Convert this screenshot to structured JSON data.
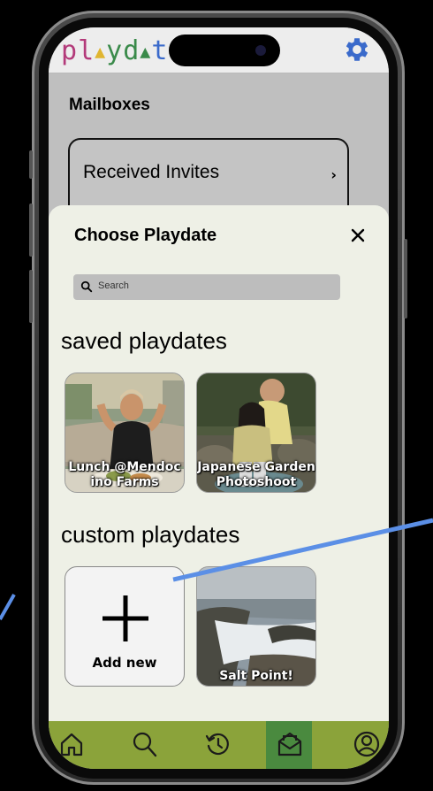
{
  "app": {
    "logo_letters": [
      {
        "ch": "p",
        "color": "#b33a7a"
      },
      {
        "ch": "l",
        "color": "#b33a7a"
      },
      {
        "ch": "▲",
        "color": "#e0b530"
      },
      {
        "ch": "y",
        "color": "#3a8a4a"
      },
      {
        "ch": "d",
        "color": "#3a8a4a"
      },
      {
        "ch": "▲",
        "color": "#3a8a4a"
      },
      {
        "ch": "t",
        "color": "#3a6acb"
      }
    ],
    "gear_color": "#3a6acb"
  },
  "mailbox": {
    "title": "Mailboxes",
    "received_label": "Received Invites",
    "chevron": "›"
  },
  "sheet": {
    "title": "Choose Playdate",
    "close": "✕",
    "search_placeholder": "Search",
    "saved_heading": "saved playdates",
    "custom_heading": "custom playdates",
    "saved": [
      {
        "label": "Lunch @Mendoc ino Farms"
      },
      {
        "label": "Japanese Garden Photoshoot"
      }
    ],
    "custom": [
      {
        "label": "Add new"
      },
      {
        "label": "Salt Point!"
      }
    ]
  },
  "nav": {
    "items": [
      "home-icon",
      "search-icon",
      "history-icon",
      "mailbox-icon",
      "profile-icon"
    ],
    "active": "mailbox-icon",
    "bar_color": "#8ba33a",
    "active_color": "#4a8a3f"
  },
  "annotation_color": "#5b8fe6"
}
